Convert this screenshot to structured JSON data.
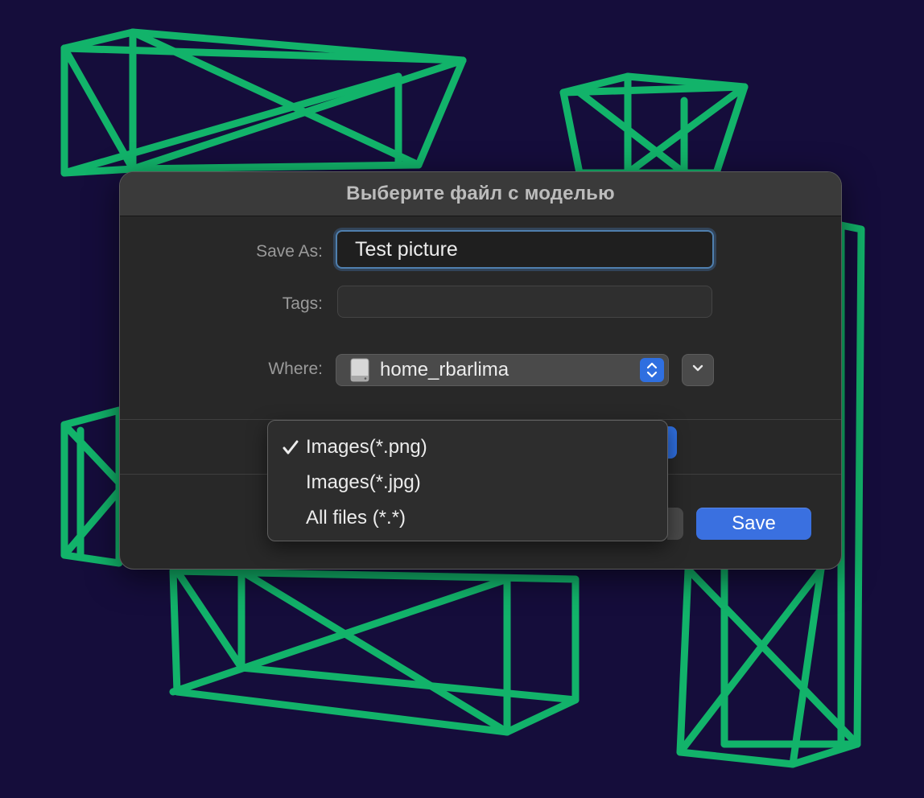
{
  "dialog": {
    "title": "Выберите файл с моделью",
    "save_as_label": "Save As:",
    "save_as_value": "Test picture",
    "tags_label": "Tags:",
    "tags_value": "",
    "where_label": "Where:",
    "where_value": "home_rbarlima",
    "save_button": "Save"
  },
  "file_type_menu": {
    "selected_index": 0,
    "items": [
      {
        "label": "Images(*.png)",
        "checked": true
      },
      {
        "label": "Images(*.jpg)",
        "checked": false
      },
      {
        "label": "All files (*.*)",
        "checked": false
      }
    ]
  },
  "icons": {
    "where_icon": "drive-icon",
    "where_stepper": "chevron-updown-icon",
    "expand": "chevron-down-icon",
    "checkmark": "checkmark-icon"
  },
  "colors": {
    "background": "#150d3b",
    "wireframe": "#12b36a",
    "accent": "#3a70e0"
  }
}
